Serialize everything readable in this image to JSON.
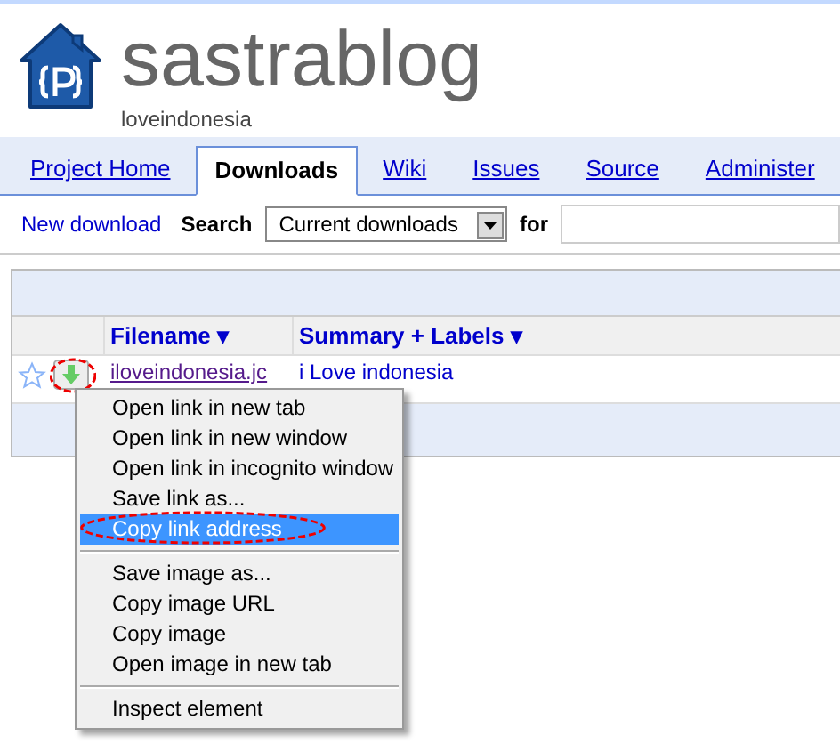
{
  "project": {
    "title": "sastrablog",
    "subtitle": "loveindonesia"
  },
  "tabs": [
    {
      "label": "Project Home",
      "selected": false
    },
    {
      "label": "Downloads",
      "selected": true
    },
    {
      "label": "Wiki",
      "selected": false
    },
    {
      "label": "Issues",
      "selected": false
    },
    {
      "label": "Source",
      "selected": false
    },
    {
      "label": "Administer",
      "selected": false
    }
  ],
  "toolbar": {
    "new_link": "New download",
    "search_label": "Search",
    "search_scope": "Current downloads",
    "for_label": "for"
  },
  "table": {
    "columns": [
      "Filename ▾",
      "Summary + Labels ▾"
    ],
    "rows": [
      {
        "starred": false,
        "filename": "iloveindonesia.jc",
        "summary": "i Love indonesia"
      }
    ]
  },
  "context_menu": [
    {
      "kind": "item",
      "label": "Open link in new tab",
      "selected": false
    },
    {
      "kind": "item",
      "label": "Open link in new window",
      "selected": false
    },
    {
      "kind": "item",
      "label": "Open link in incognito window",
      "selected": false
    },
    {
      "kind": "item",
      "label": "Save link as...",
      "selected": false
    },
    {
      "kind": "item",
      "label": "Copy link address",
      "selected": true
    },
    {
      "kind": "separator"
    },
    {
      "kind": "item",
      "label": "Save image as...",
      "selected": false
    },
    {
      "kind": "item",
      "label": "Copy image URL",
      "selected": false
    },
    {
      "kind": "item",
      "label": "Copy image",
      "selected": false
    },
    {
      "kind": "item",
      "label": "Open image in new tab",
      "selected": false
    },
    {
      "kind": "separator"
    },
    {
      "kind": "item",
      "label": "Inspect element",
      "selected": false
    }
  ]
}
